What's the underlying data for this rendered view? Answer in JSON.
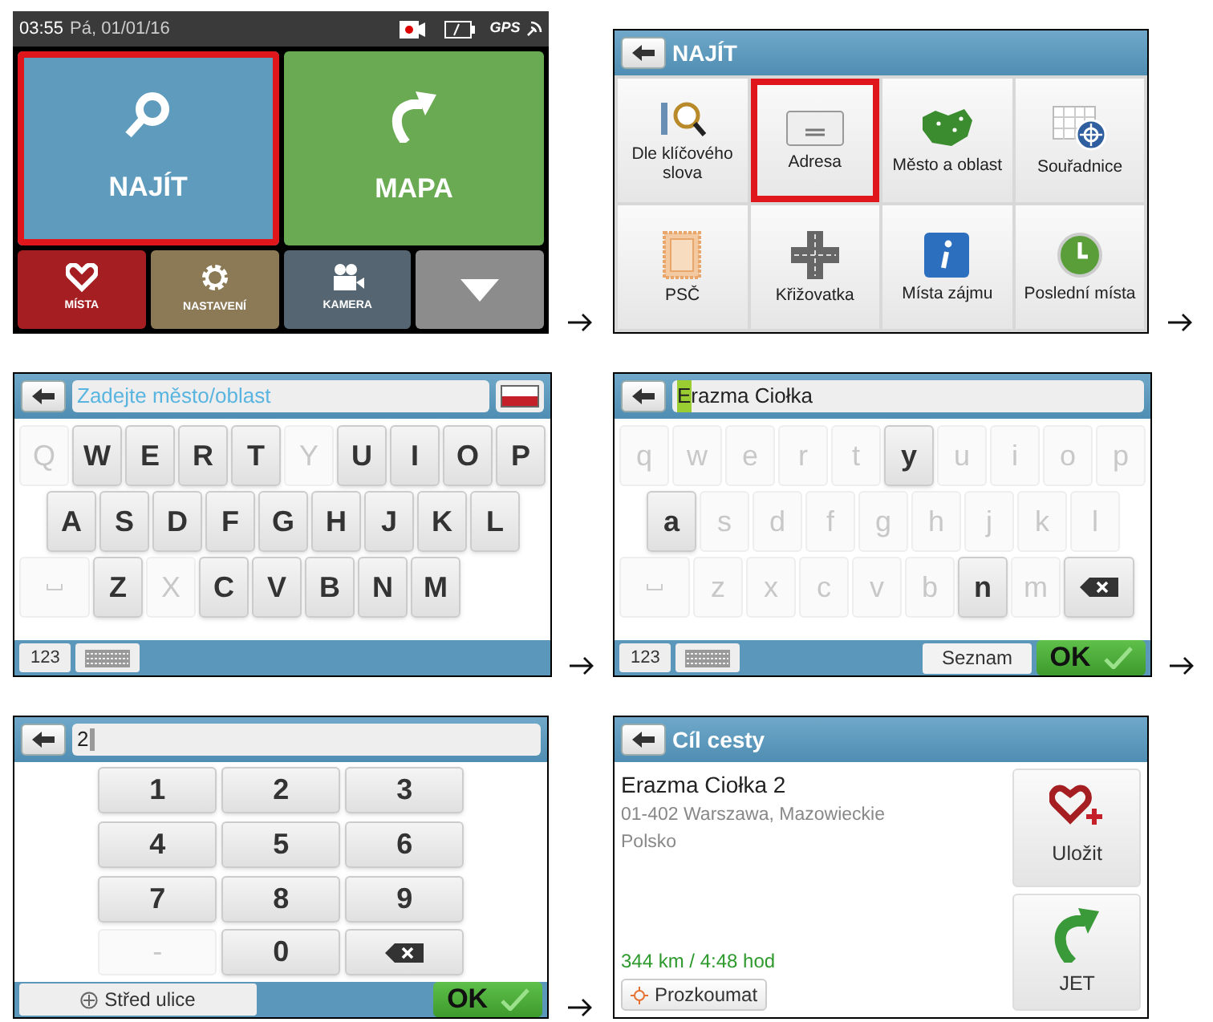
{
  "steps": [
    {
      "kind": "main_menu",
      "status_bar": {
        "time": "03:55",
        "date": "Pá, 01/01/16",
        "gps": "GPS"
      },
      "tiles": [
        {
          "label": "NAJÍT",
          "color": "#5f9bbd",
          "highlighted": true
        },
        {
          "label": "MAPA",
          "color": "#6aaa52",
          "highlighted": false
        }
      ],
      "small_tiles": [
        {
          "label": "MÍSTA",
          "color": "#a51e22"
        },
        {
          "label": "NASTAVENÍ",
          "color": "#8c7a57"
        },
        {
          "label": "KAMERA",
          "color": "#556672"
        },
        {
          "color": "#8c8c8c"
        }
      ]
    },
    {
      "kind": "menu_grid",
      "title": "NAJÍT",
      "items": [
        {
          "label": "Dle klíčového slova",
          "highlighted": false
        },
        {
          "label": "Adresa",
          "highlighted": true
        },
        {
          "label": "Město a oblast",
          "highlighted": false
        },
        {
          "label": "Souřadnice",
          "highlighted": false
        },
        {
          "label": "PSČ",
          "highlighted": false
        },
        {
          "label": "Křižovatka",
          "highlighted": false
        },
        {
          "label": "Místa zájmu",
          "highlighted": false
        },
        {
          "label": "Poslední místa",
          "highlighted": false
        }
      ]
    },
    {
      "kind": "keyboard",
      "field": {
        "placeholder": "Zadejte město/oblast"
      },
      "flag": true,
      "key_rows": [
        [
          {
            "kind": "letter",
            "label": "Q",
            "disabled": true
          },
          {
            "kind": "letter",
            "label": "W",
            "disabled": false
          },
          {
            "kind": "letter",
            "label": "E",
            "disabled": false
          },
          {
            "kind": "letter",
            "label": "R",
            "disabled": false
          },
          {
            "kind": "letter",
            "label": "T",
            "disabled": false
          },
          {
            "kind": "letter",
            "label": "Y",
            "disabled": true
          },
          {
            "kind": "letter",
            "label": "U",
            "disabled": false
          },
          {
            "kind": "letter",
            "label": "I",
            "disabled": false
          },
          {
            "kind": "letter",
            "label": "O",
            "disabled": false
          },
          {
            "kind": "letter",
            "label": "P",
            "disabled": false
          }
        ],
        [
          {
            "kind": "letter",
            "label": "A",
            "disabled": false
          },
          {
            "kind": "letter",
            "label": "S",
            "disabled": false
          },
          {
            "kind": "letter",
            "label": "D",
            "disabled": false
          },
          {
            "kind": "letter",
            "label": "F",
            "disabled": false
          },
          {
            "kind": "letter",
            "label": "G",
            "disabled": false
          },
          {
            "kind": "letter",
            "label": "H",
            "disabled": false
          },
          {
            "kind": "letter",
            "label": "J",
            "disabled": false
          },
          {
            "kind": "letter",
            "label": "K",
            "disabled": false
          },
          {
            "kind": "letter",
            "label": "L",
            "disabled": false
          }
        ],
        [
          {
            "kind": "space",
            "disabled": true
          },
          {
            "kind": "letter",
            "label": "Z",
            "disabled": false
          },
          {
            "kind": "letter",
            "label": "X",
            "disabled": true
          },
          {
            "kind": "letter",
            "label": "C",
            "disabled": false
          },
          {
            "kind": "letter",
            "label": "V",
            "disabled": false
          },
          {
            "kind": "letter",
            "label": "B",
            "disabled": false
          },
          {
            "kind": "letter",
            "label": "N",
            "disabled": false
          },
          {
            "kind": "letter",
            "label": "M",
            "disabled": false
          }
        ]
      ],
      "bottom": {
        "numbers_button": "123"
      }
    },
    {
      "kind": "keyboard",
      "field": {
        "value_parts": [
          {
            "text": "E",
            "highlighted": true
          },
          {
            "text": "razma Ciołka",
            "highlighted": false
          }
        ]
      },
      "flag": false,
      "key_rows": [
        [
          {
            "kind": "letter",
            "label": "q",
            "disabled": true
          },
          {
            "kind": "letter",
            "label": "w",
            "disabled": true
          },
          {
            "kind": "letter",
            "label": "e",
            "disabled": true
          },
          {
            "kind": "letter",
            "label": "r",
            "disabled": true
          },
          {
            "kind": "letter",
            "label": "t",
            "disabled": true
          },
          {
            "kind": "letter",
            "label": "y",
            "disabled": false
          },
          {
            "kind": "letter",
            "label": "u",
            "disabled": true
          },
          {
            "kind": "letter",
            "label": "i",
            "disabled": true
          },
          {
            "kind": "letter",
            "label": "o",
            "disabled": true
          },
          {
            "kind": "letter",
            "label": "p",
            "disabled": true
          }
        ],
        [
          {
            "kind": "letter",
            "label": "a",
            "disabled": false
          },
          {
            "kind": "letter",
            "label": "s",
            "disabled": true
          },
          {
            "kind": "letter",
            "label": "d",
            "disabled": true
          },
          {
            "kind": "letter",
            "label": "f",
            "disabled": true
          },
          {
            "kind": "letter",
            "label": "g",
            "disabled": true
          },
          {
            "kind": "letter",
            "label": "h",
            "disabled": true
          },
          {
            "kind": "letter",
            "label": "j",
            "disabled": true
          },
          {
            "kind": "letter",
            "label": "k",
            "disabled": true
          },
          {
            "kind": "letter",
            "label": "l",
            "disabled": true
          }
        ],
        [
          {
            "kind": "space",
            "disabled": true
          },
          {
            "kind": "letter",
            "label": "z",
            "disabled": true
          },
          {
            "kind": "letter",
            "label": "x",
            "disabled": true
          },
          {
            "kind": "letter",
            "label": "c",
            "disabled": true
          },
          {
            "kind": "letter",
            "label": "v",
            "disabled": true
          },
          {
            "kind": "letter",
            "label": "b",
            "disabled": true
          },
          {
            "kind": "letter",
            "label": "n",
            "disabled": false
          },
          {
            "kind": "letter",
            "label": "m",
            "disabled": true
          },
          {
            "kind": "backspace",
            "disabled": false
          }
        ]
      ],
      "bottom": {
        "numbers_button": "123",
        "list_button": "Seznam",
        "ok_button": "OK"
      }
    },
    {
      "kind": "numpad",
      "field": {
        "value": "2"
      },
      "keys": [
        {
          "kind": "digit",
          "label": "1",
          "disabled": false
        },
        {
          "kind": "digit",
          "label": "2",
          "disabled": false
        },
        {
          "kind": "digit",
          "label": "3",
          "disabled": false
        },
        {
          "kind": "digit",
          "label": "4",
          "disabled": false
        },
        {
          "kind": "digit",
          "label": "5",
          "disabled": false
        },
        {
          "kind": "digit",
          "label": "6",
          "disabled": false
        },
        {
          "kind": "digit",
          "label": "7",
          "disabled": false
        },
        {
          "kind": "digit",
          "label": "8",
          "disabled": false
        },
        {
          "kind": "digit",
          "label": "9",
          "disabled": false
        },
        {
          "kind": "digit",
          "label": "-",
          "disabled": true
        },
        {
          "kind": "digit",
          "label": "0",
          "disabled": false
        },
        {
          "kind": "backspace",
          "disabled": false
        }
      ],
      "bottom": {
        "center_button": "Střed ulice",
        "ok_button": "OK"
      }
    },
    {
      "kind": "destination",
      "title": "Cíl cesty",
      "name": "Erazma Ciołka 2",
      "address_lines": [
        "01-402 Warszawa, Mazowieckie",
        "Polsko"
      ],
      "distance": "344 km / 4:48 hod",
      "explore_button": "Prozkoumat",
      "save_button": "Uložit",
      "go_button": "JET"
    }
  ]
}
